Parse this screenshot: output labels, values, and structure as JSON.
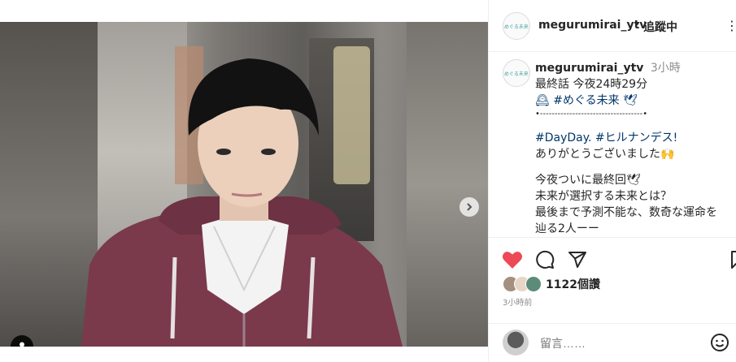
{
  "post": {
    "photo_alt": "",
    "icons": {
      "next": "chevron-right-icon",
      "user_tag": "user-icon"
    }
  },
  "header": {
    "avatar_text": "めぐる未来",
    "username": "megurumirai_ytv",
    "separator": "•",
    "follow_status": "追蹤中",
    "more_icon": "more-icon"
  },
  "caption": {
    "username": "megurumirai_ytv",
    "time": "3小時",
    "lines": [
      "最終話 今夜24時29分",
      "🕰 #めぐる未来 🕊",
      "•-----------------------------------•",
      "",
      "#DayDay. #ヒルナンデス!",
      "ありがとうございました🙌",
      "",
      "今夜ついに最終回🕊",
      "未来が選択する未来とは？",
      "最後まで予測不能な、数奇な運命を",
      "辿る2人ーー"
    ]
  },
  "actions": {
    "like": "heart-icon",
    "comment": "comment-icon",
    "share": "share-icon",
    "save": "bookmark-icon"
  },
  "likes": {
    "count_text": "1122個讚"
  },
  "post_time": "3小時前",
  "comment_box": {
    "placeholder": "留言……",
    "emoji_icon": "emoji-icon"
  },
  "colors": {
    "like": "#ed4956",
    "tag": "#00376b",
    "muted": "#8e8e8e"
  }
}
